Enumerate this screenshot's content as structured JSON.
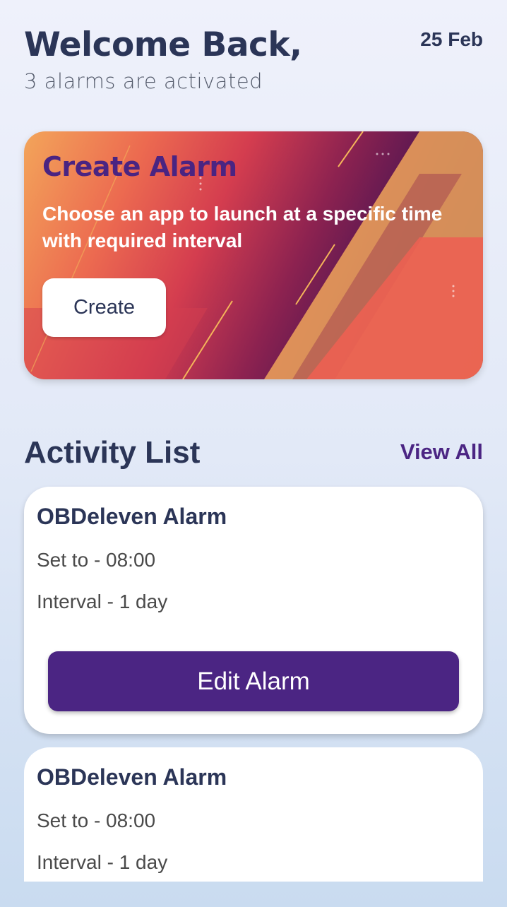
{
  "header": {
    "title": "Welcome Back,",
    "subtitle": "3 alarms are activated",
    "date": "25 Feb"
  },
  "banner": {
    "title": "Create Alarm",
    "description": "Choose an app to launch at a specific time with required interval",
    "button_label": "Create"
  },
  "activity": {
    "heading": "Activity List",
    "view_all": "View All",
    "items": [
      {
        "name": "OBDeleven Alarm",
        "set_to": "Set to - 08:00",
        "interval": "Interval - 1 day",
        "button": "Edit Alarm"
      },
      {
        "name": "OBDeleven Alarm",
        "set_to": "Set to - 08:00",
        "interval": "Interval - 1 day"
      }
    ]
  }
}
